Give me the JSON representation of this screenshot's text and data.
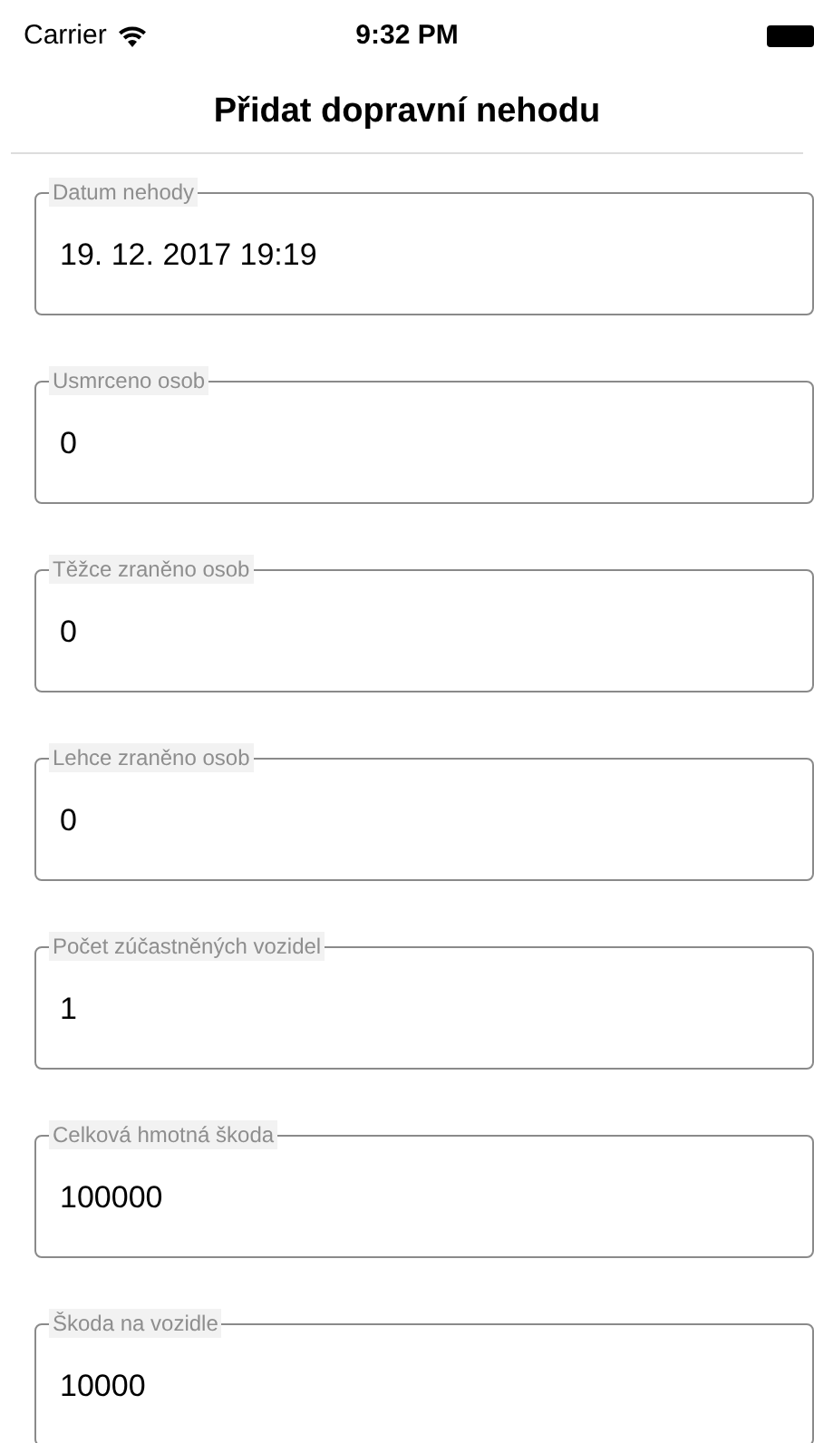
{
  "status_bar": {
    "carrier": "Carrier",
    "time": "9:32 PM"
  },
  "nav_bar": {
    "title": "Přidat dopravní nehodu"
  },
  "fields": [
    {
      "label": "Datum nehody",
      "value": "19. 12. 2017 19:19"
    },
    {
      "label": "Usmrceno osob",
      "value": "0"
    },
    {
      "label": "Těžce zraněno osob",
      "value": "0"
    },
    {
      "label": "Lehce zraněno osob",
      "value": "0"
    },
    {
      "label": "Počet zúčastněných vozidel",
      "value": "1"
    },
    {
      "label": "Celková hmotná škoda",
      "value": "100000"
    },
    {
      "label": "Škoda na vozidle",
      "value": "10000"
    }
  ]
}
